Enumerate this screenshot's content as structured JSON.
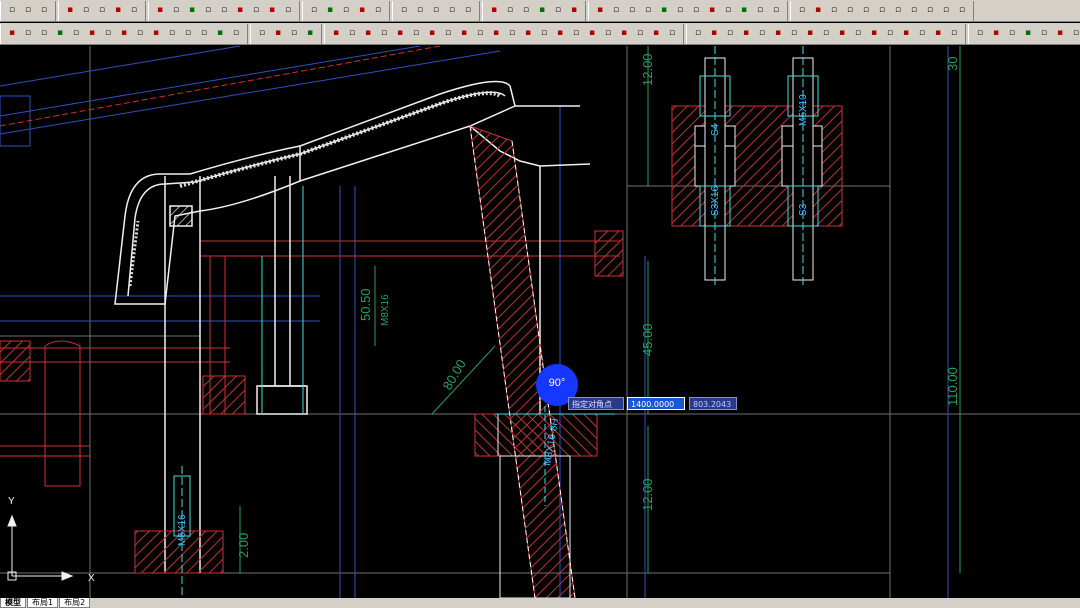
{
  "toolbar_row1": [
    [
      "blk",
      "blk",
      "blk"
    ],
    [
      "red",
      "blk",
      "blk",
      "red",
      "blk"
    ],
    [
      "red",
      "blk",
      "grn",
      "blk",
      "blk",
      "red",
      "blk",
      "red",
      "blk"
    ],
    [
      "blk",
      "grn",
      "blk",
      "red",
      "blk"
    ],
    [
      "blk",
      "blk",
      "blk",
      "blk",
      "blk"
    ],
    [
      "red",
      "blk",
      "blk",
      "grn",
      "blk",
      "red"
    ],
    [
      "red",
      "blk",
      "blk",
      "blk",
      "grn",
      "blk",
      "blk",
      "red",
      "blk",
      "grn",
      "blk",
      "blk"
    ],
    [
      "blk",
      "red",
      "blk",
      "blk",
      "blk",
      "blk",
      "blk",
      "blk",
      "blk",
      "blk",
      "blk"
    ]
  ],
  "toolbar_row2": [
    [
      "red",
      "blk",
      "blk",
      "grn",
      "blk",
      "red",
      "blk",
      "red",
      "blk",
      "red",
      "blk",
      "blk",
      "blk",
      "grn",
      "blk"
    ],
    [
      "blk",
      "red",
      "blk",
      "grn"
    ],
    [
      "red",
      "blk",
      "red",
      "blk",
      "red",
      "blk",
      "red",
      "blk",
      "red",
      "blk",
      "red",
      "blk",
      "red",
      "blk",
      "red",
      "blk",
      "red",
      "blk",
      "red",
      "blk",
      "red",
      "blk"
    ],
    [
      "blk",
      "red",
      "blk",
      "red",
      "blk",
      "red",
      "blk",
      "red",
      "blk",
      "red",
      "blk",
      "red",
      "blk",
      "red",
      "blk",
      "red",
      "blk"
    ],
    [
      "blk",
      "red",
      "blk",
      "grn",
      "blk",
      "red",
      "blk"
    ]
  ],
  "drawing": {
    "dimensions": [
      {
        "text": "12.00"
      },
      {
        "text": "30"
      },
      {
        "text": "45.00"
      },
      {
        "text": "110.00"
      },
      {
        "text": "12.00"
      },
      {
        "text": "80.00"
      },
      {
        "text": "2.00"
      },
      {
        "text": "50.50"
      }
    ],
    "component_labels": [
      {
        "text": "M5X16"
      },
      {
        "text": "S4"
      },
      {
        "text": "S3"
      },
      {
        "text": "S3X16"
      },
      {
        "text": "M5X10"
      },
      {
        "text": "M8X16-8H"
      },
      {
        "text": "M8X16"
      }
    ],
    "cursor_angle": "90°",
    "axis_y": "Y",
    "axis_x": "X"
  },
  "dynamic_input": {
    "label": "指定对角点",
    "value1": "1400.0000",
    "value2": "803.2043"
  },
  "status": {
    "tabs": [
      "模型",
      "布局1",
      "布局2"
    ]
  },
  "colors": {
    "toolbar_bg": "#d4d0c8",
    "canvas_bg": "#000000",
    "outline": "#ffffff",
    "hatch_red": "#d03030",
    "dimension_green": "#22a060",
    "centerline_cyan": "#40e0e0",
    "cursor_blue": "#1637ff"
  }
}
